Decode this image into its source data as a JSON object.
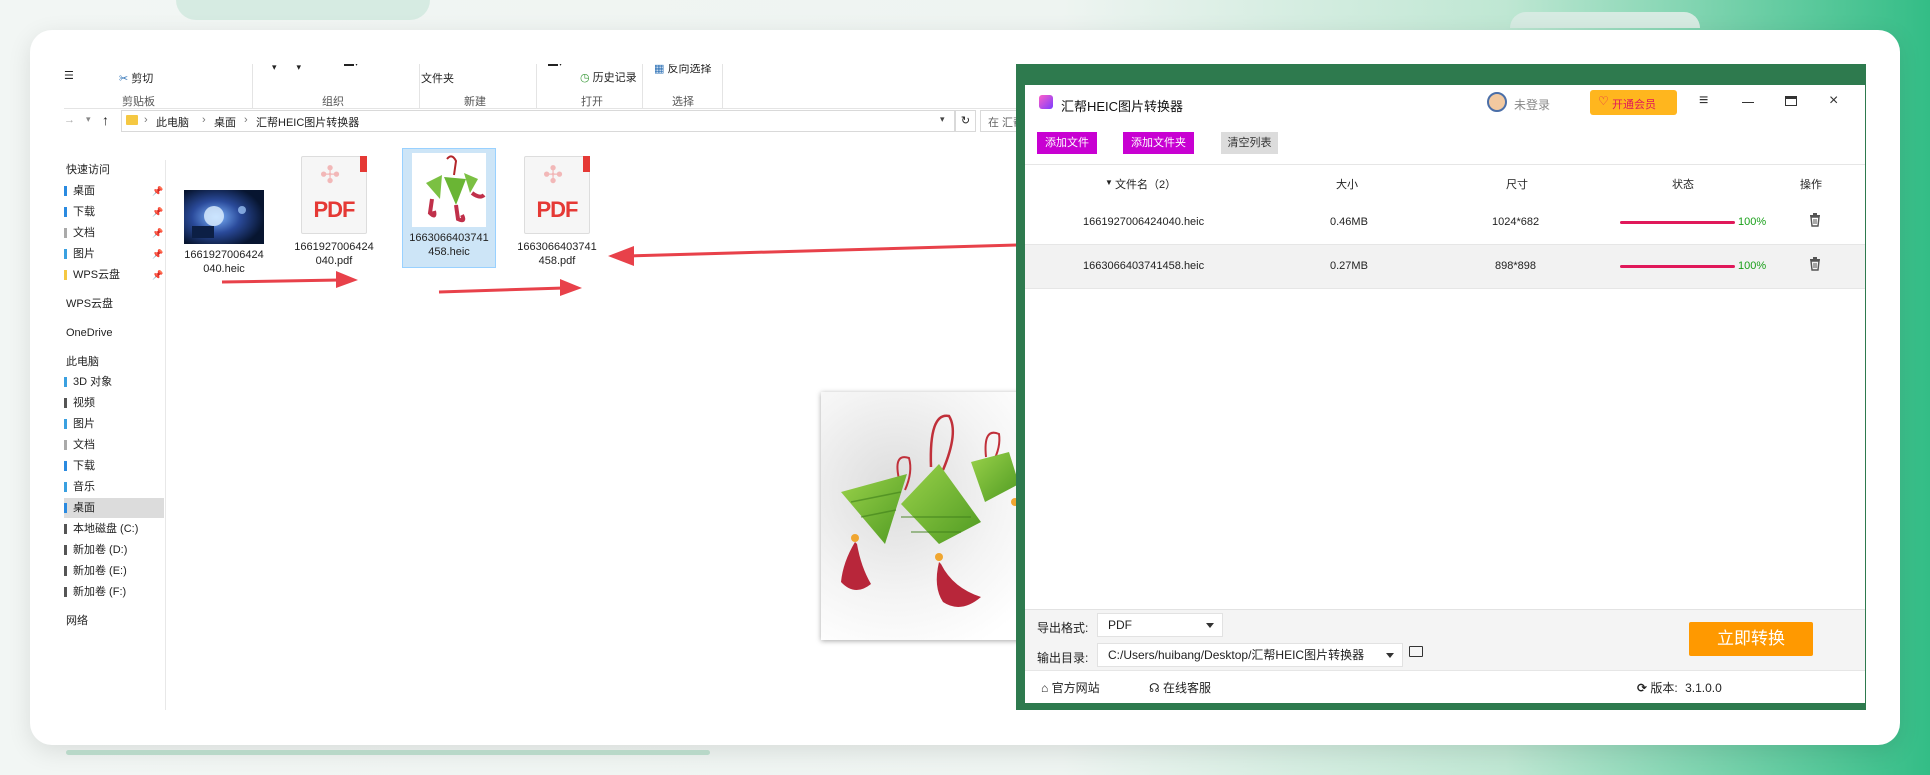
{
  "colors": {
    "accent_magenta": "#c800d2",
    "convert_orange": "#ff9900",
    "vip_orange": "#ffb61e",
    "progress_red": "#e0185a",
    "progress_text_green": "#1aa01a",
    "frame_green": "#2e7a4e",
    "explorer_selection": "#cde5f7"
  },
  "explorer": {
    "ribbon": {
      "cut": "剪切",
      "clipboard_group": "剪贴板",
      "organize_group": "组织",
      "new_folder_partial": "文件夹",
      "new_group": "新建",
      "history": "历史记录",
      "open_group": "打开",
      "invert_select": "反向选择",
      "select_group": "选择"
    },
    "address": {
      "breadcrumbs": [
        "此电脑",
        "桌面",
        "汇帮HEIC图片转换器"
      ],
      "search_placeholder": "在 汇帮H..."
    },
    "nav": [
      {
        "label": "快速访问",
        "icon": "star-icon"
      },
      {
        "label": "桌面",
        "icon": "desktop-icon",
        "pinned": true
      },
      {
        "label": "下载",
        "icon": "download-icon",
        "pinned": true
      },
      {
        "label": "文档",
        "icon": "document-icon",
        "pinned": true
      },
      {
        "label": "图片",
        "icon": "picture-icon",
        "pinned": true
      },
      {
        "label": "WPS云盘",
        "icon": "folder-icon",
        "pinned": true
      },
      {
        "label": "WPS云盘",
        "icon": "cloud-icon"
      },
      {
        "label": "OneDrive",
        "icon": "onedrive-icon"
      },
      {
        "label": "此电脑",
        "icon": "computer-icon"
      },
      {
        "label": "3D 对象",
        "icon": "cube-icon"
      },
      {
        "label": "视频",
        "icon": "video-icon"
      },
      {
        "label": "图片",
        "icon": "picture-icon"
      },
      {
        "label": "文档",
        "icon": "document-icon"
      },
      {
        "label": "下载",
        "icon": "download-icon"
      },
      {
        "label": "音乐",
        "icon": "music-icon"
      },
      {
        "label": "桌面",
        "icon": "desktop-icon",
        "selected": true
      },
      {
        "label": "本地磁盘 (C:)",
        "icon": "drive-icon"
      },
      {
        "label": "新加卷 (D:)",
        "icon": "drive-icon"
      },
      {
        "label": "新加卷 (E:)",
        "icon": "drive-icon"
      },
      {
        "label": "新加卷 (F:)",
        "icon": "drive-icon"
      },
      {
        "label": "网络",
        "icon": "network-icon"
      }
    ],
    "files": [
      {
        "line1": "1661927006424",
        "line2": "040.heic",
        "kind": "heic-photo"
      },
      {
        "line1": "1661927006424",
        "line2": "040.pdf",
        "kind": "pdf"
      },
      {
        "line1": "1663066403741",
        "line2": "458.heic",
        "kind": "heic-zongzi",
        "selected": true
      },
      {
        "line1": "1663066403741",
        "line2": "458.pdf",
        "kind": "pdf"
      }
    ],
    "pdf_badge": "PDF"
  },
  "converter": {
    "title": "汇帮HEIC图片转换器",
    "login": "未登录",
    "vip": "开通会员",
    "toolbar": {
      "add_file": "添加文件",
      "add_folder": "添加文件夹",
      "clear_list": "清空列表"
    },
    "table": {
      "headers": {
        "filename": "文件名（2）",
        "size": "大小",
        "dims": "尺寸",
        "status": "状态",
        "actions": "操作"
      },
      "rows": [
        {
          "name": "1661927006424040.heic",
          "size": "0.46MB",
          "dims": "1024*682",
          "progress": 100,
          "pct": "100%"
        },
        {
          "name": "1663066403741458.heic",
          "size": "0.27MB",
          "dims": "898*898",
          "progress": 100,
          "pct": "100%"
        }
      ]
    },
    "output": {
      "format_label": "导出格式:",
      "format_value": "PDF",
      "dir_label": "输出目录:",
      "dir_value": "C:/Users/huibang/Desktop/汇帮HEIC图片转换器",
      "convert": "立即转换"
    },
    "statusbar": {
      "website": "官方网站",
      "support": "在线客服",
      "version_label": "版本:",
      "version": "3.1.0.0"
    }
  }
}
